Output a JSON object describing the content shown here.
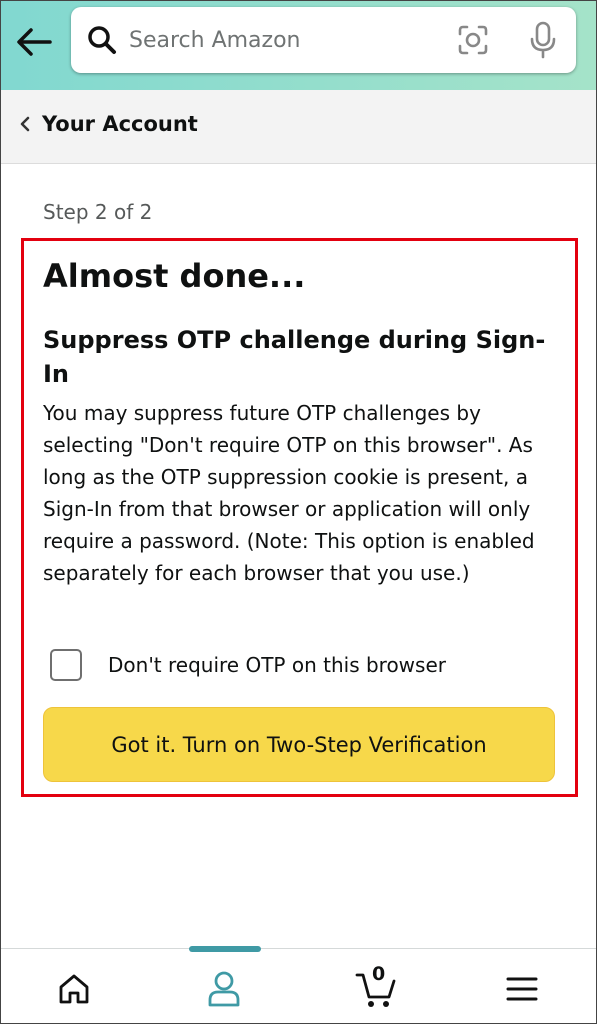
{
  "header": {
    "search_placeholder": "Search Amazon",
    "back_icon": "arrow-left-icon",
    "camera_icon": "camera-lens-icon",
    "mic_icon": "microphone-icon"
  },
  "breadcrumb": {
    "label": "Your Account"
  },
  "main": {
    "step": "Step 2 of 2",
    "title": "Almost done...",
    "subtitle": "Suppress OTP challenge during Sign-In",
    "body": "You may suppress future OTP challenges by selecting \"Don't require OTP on this browser\". As long as the OTP suppression cookie is present, a Sign-In from that browser or application will only require a password. (Note: This option is enabled separately for each browser that you use.)",
    "checkbox_label": "Don't require OTP on this browser",
    "checkbox_checked": false,
    "button_label": "Got it. Turn on Two-Step Verification"
  },
  "bottom_nav": {
    "cart_count": "0",
    "items": [
      "home-icon",
      "account-icon",
      "cart-icon",
      "menu-icon"
    ],
    "active": "account-icon"
  },
  "colors": {
    "header_gradient_start": "#81d8d0",
    "header_gradient_end": "#a5e3c9",
    "highlight_border": "#e3000f",
    "button_bg": "#f7d84a",
    "active_nav": "#3f9aa5"
  }
}
